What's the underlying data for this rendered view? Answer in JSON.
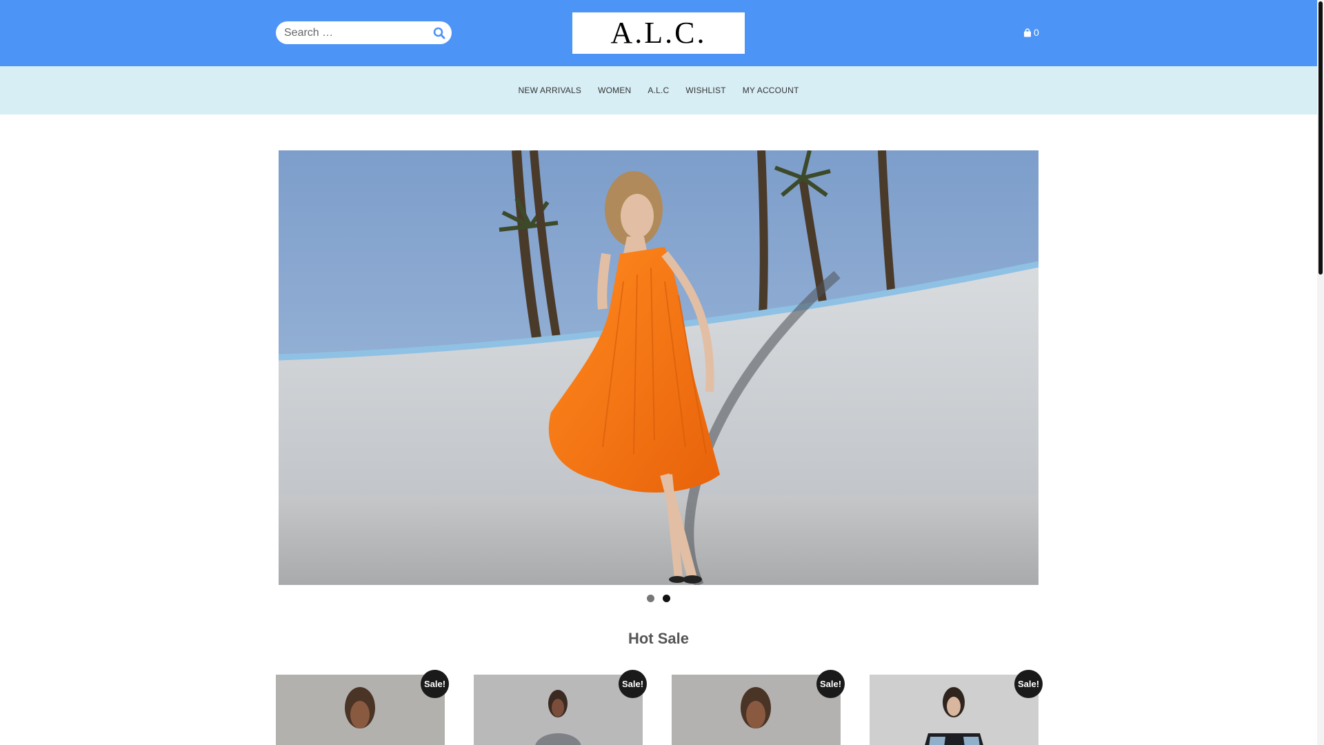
{
  "header": {
    "search": {
      "placeholder": "Search …"
    },
    "logo": "A.L.C.",
    "cart": {
      "count": "0"
    }
  },
  "nav": {
    "items": [
      {
        "label": "NEW ARRIVALS"
      },
      {
        "label": "WOMEN"
      },
      {
        "label": "A.L.C"
      },
      {
        "label": "WISHLIST"
      },
      {
        "label": "MY ACCOUNT"
      }
    ]
  },
  "hero": {
    "slides": 2,
    "active_slide": 2
  },
  "section": {
    "title": "Hot Sale"
  },
  "products": [
    {
      "badge": "Sale!"
    },
    {
      "badge": "Sale!"
    },
    {
      "badge": "Sale!"
    },
    {
      "badge": "Sale!"
    }
  ],
  "colors": {
    "header_bg": "#4d94f7",
    "nav_bg": "#d7eef5",
    "badge_bg": "#1a1a1a"
  }
}
